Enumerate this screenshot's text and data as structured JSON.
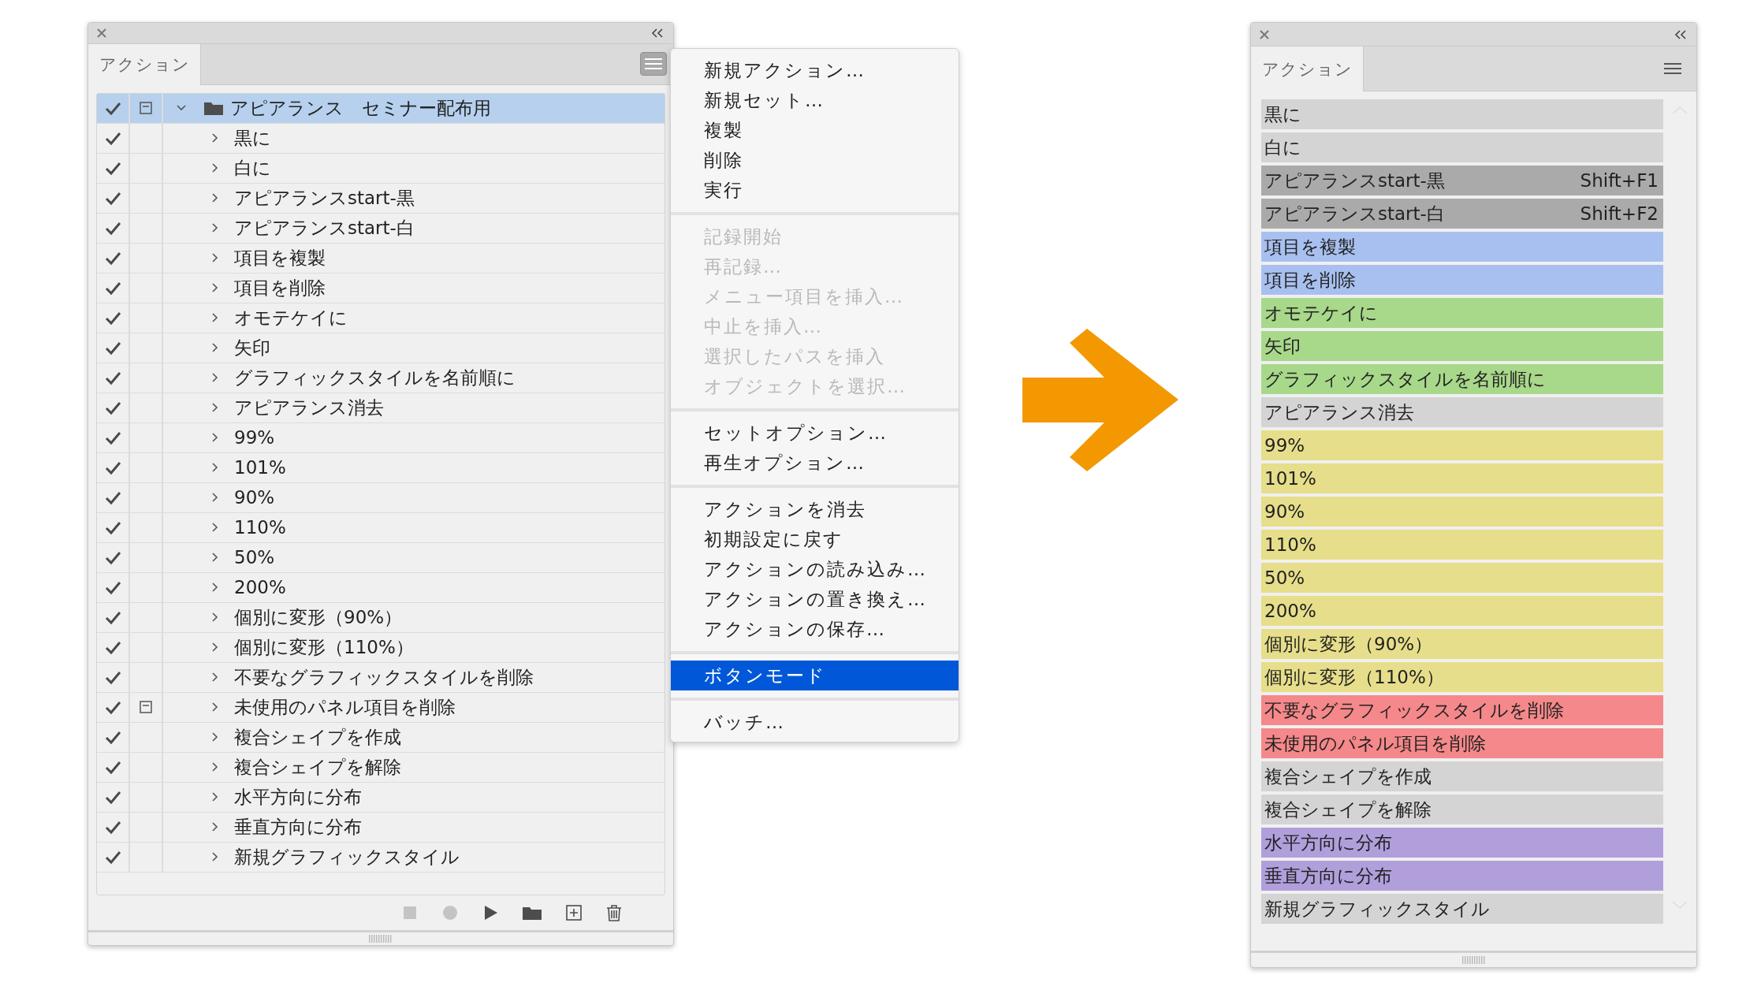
{
  "left_panel": {
    "tabs": [
      {
        "label": "アクション",
        "selected": true
      }
    ],
    "action_set": {
      "name": "アピアランス　セミナー配布用",
      "checked": true,
      "dialog": true,
      "expanded": true,
      "selected": true,
      "children": [
        {
          "name": "黒に",
          "checked": true,
          "dialog": false,
          "expanded": false,
          "selected": false
        },
        {
          "name": "白に",
          "checked": true,
          "dialog": false,
          "expanded": false,
          "selected": false
        },
        {
          "name": "アピアランスstart-黒",
          "checked": true,
          "dialog": false,
          "expanded": false,
          "selected": false
        },
        {
          "name": "アピアランスstart-白",
          "checked": true,
          "dialog": false,
          "expanded": false,
          "selected": false
        },
        {
          "name": "項目を複製",
          "checked": true,
          "dialog": false,
          "expanded": false,
          "selected": false
        },
        {
          "name": "項目を削除",
          "checked": true,
          "dialog": false,
          "expanded": false,
          "selected": false
        },
        {
          "name": "オモテケイに",
          "checked": true,
          "dialog": false,
          "expanded": false,
          "selected": false
        },
        {
          "name": "矢印",
          "checked": true,
          "dialog": false,
          "expanded": false,
          "selected": false
        },
        {
          "name": "グラフィックスタイルを名前順に",
          "checked": true,
          "dialog": false,
          "expanded": false,
          "selected": false
        },
        {
          "name": "アピアランス消去",
          "checked": true,
          "dialog": false,
          "expanded": false,
          "selected": false
        },
        {
          "name": "99%",
          "checked": true,
          "dialog": false,
          "expanded": false,
          "selected": false
        },
        {
          "name": "101%",
          "checked": true,
          "dialog": false,
          "expanded": false,
          "selected": false
        },
        {
          "name": "90%",
          "checked": true,
          "dialog": false,
          "expanded": false,
          "selected": false
        },
        {
          "name": "110%",
          "checked": true,
          "dialog": false,
          "expanded": false,
          "selected": false
        },
        {
          "name": "50%",
          "checked": true,
          "dialog": false,
          "expanded": false,
          "selected": false
        },
        {
          "name": "200%",
          "checked": true,
          "dialog": false,
          "expanded": false,
          "selected": false
        },
        {
          "name": "個別に変形（90%）",
          "checked": true,
          "dialog": false,
          "expanded": false,
          "selected": false
        },
        {
          "name": "個別に変形（110%）",
          "checked": true,
          "dialog": false,
          "expanded": false,
          "selected": false
        },
        {
          "name": "不要なグラフィックスタイルを削除",
          "checked": true,
          "dialog": false,
          "expanded": false,
          "selected": false
        },
        {
          "name": "未使用のパネル項目を削除",
          "checked": true,
          "dialog": true,
          "expanded": false,
          "selected": false
        },
        {
          "name": "複合シェイプを作成",
          "checked": true,
          "dialog": false,
          "expanded": false,
          "selected": false
        },
        {
          "name": "複合シェイプを解除",
          "checked": true,
          "dialog": false,
          "expanded": false,
          "selected": false
        },
        {
          "name": "水平方向に分布",
          "checked": true,
          "dialog": false,
          "expanded": false,
          "selected": false
        },
        {
          "name": "垂直方向に分布",
          "checked": true,
          "dialog": false,
          "expanded": false,
          "selected": false
        },
        {
          "name": "新規グラフィックスタイル",
          "checked": true,
          "dialog": false,
          "expanded": false,
          "selected": false
        }
      ]
    },
    "toolbar": [
      {
        "kind": "stop",
        "disabled": true
      },
      {
        "kind": "record",
        "disabled": true
      },
      {
        "kind": "play",
        "disabled": false
      },
      {
        "kind": "folder",
        "disabled": false
      },
      {
        "kind": "new",
        "disabled": false
      },
      {
        "kind": "delete",
        "disabled": false
      }
    ]
  },
  "panel_menu": {
    "groups": [
      {
        "items": [
          {
            "label": "新規アクション…",
            "disabled": false,
            "selected": false
          },
          {
            "label": "新規セット…",
            "disabled": false,
            "selected": false
          },
          {
            "label": "複製",
            "disabled": false,
            "selected": false
          },
          {
            "label": "削除",
            "disabled": false,
            "selected": false
          },
          {
            "label": "実行",
            "disabled": false,
            "selected": false
          }
        ]
      },
      {
        "items": [
          {
            "label": "記録開始",
            "disabled": true,
            "selected": false
          },
          {
            "label": "再記録…",
            "disabled": true,
            "selected": false
          },
          {
            "label": "メニュー項目を挿入…",
            "disabled": true,
            "selected": false
          },
          {
            "label": "中止を挿入…",
            "disabled": true,
            "selected": false
          },
          {
            "label": "選択したパスを挿入",
            "disabled": true,
            "selected": false
          },
          {
            "label": "オブジェクトを選択…",
            "disabled": true,
            "selected": false
          }
        ]
      },
      {
        "items": [
          {
            "label": "セットオプション…",
            "disabled": false,
            "selected": false
          },
          {
            "label": "再生オプション…",
            "disabled": false,
            "selected": false
          }
        ]
      },
      {
        "items": [
          {
            "label": "アクションを消去",
            "disabled": false,
            "selected": false
          },
          {
            "label": "初期設定に戻す",
            "disabled": false,
            "selected": false
          },
          {
            "label": "アクションの読み込み…",
            "disabled": false,
            "selected": false
          },
          {
            "label": "アクションの置き換え…",
            "disabled": false,
            "selected": false
          },
          {
            "label": "アクションの保存…",
            "disabled": false,
            "selected": false
          }
        ]
      },
      {
        "items": [
          {
            "label": "ボタンモード",
            "disabled": false,
            "selected": true
          }
        ]
      },
      {
        "items": [
          {
            "label": "バッチ…",
            "disabled": false,
            "selected": false
          }
        ]
      }
    ]
  },
  "button_mode_panel": {
    "tabs": [
      {
        "label": "アクション",
        "selected": true
      }
    ],
    "buttons": [
      {
        "name": "黒に",
        "color": "#d4d4d4"
      },
      {
        "name": "白に",
        "color": "#d4d4d4"
      },
      {
        "name": "アピアランスstart-黒",
        "shortcut": "Shift+F1",
        "color": "#aaaaaa"
      },
      {
        "name": "アピアランスstart-白",
        "shortcut": "Shift+F2",
        "color": "#aaaaaa"
      },
      {
        "name": "項目を複製",
        "color": "#a8c0f0"
      },
      {
        "name": "項目を削除",
        "color": "#a8c0f0"
      },
      {
        "name": "オモテケイに",
        "color": "#a8d88a"
      },
      {
        "name": "矢印",
        "color": "#a8d88a"
      },
      {
        "name": "グラフィックスタイルを名前順に",
        "color": "#a8d88a"
      },
      {
        "name": "アピアランス消去",
        "color": "#d4d4d4"
      },
      {
        "name": "99%",
        "color": "#e6de8a"
      },
      {
        "name": "101%",
        "color": "#e6de8a"
      },
      {
        "name": "90%",
        "color": "#e6de8a"
      },
      {
        "name": "110%",
        "color": "#e6de8a"
      },
      {
        "name": "50%",
        "color": "#e6de8a"
      },
      {
        "name": "200%",
        "color": "#e6de8a"
      },
      {
        "name": "個別に変形（90%）",
        "color": "#e6de8a"
      },
      {
        "name": "個別に変形（110%）",
        "color": "#e6de8a"
      },
      {
        "name": "不要なグラフィックスタイルを削除",
        "color": "#f5888a"
      },
      {
        "name": "未使用のパネル項目を削除",
        "color": "#f5888a"
      },
      {
        "name": "複合シェイプを作成",
        "color": "#d4d4d4"
      },
      {
        "name": "複合シェイプを解除",
        "color": "#d4d4d4"
      },
      {
        "name": "水平方向に分布",
        "color": "#b19fdc"
      },
      {
        "name": "垂直方向に分布",
        "color": "#b19fdc"
      },
      {
        "name": "新規グラフィックスタイル",
        "color": "#d4d4d4"
      }
    ]
  }
}
